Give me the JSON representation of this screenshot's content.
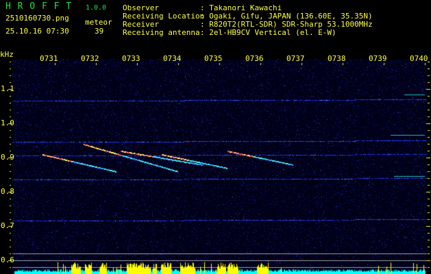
{
  "header": {
    "app_name": "H R O F F T",
    "version": "1.0.0",
    "filename": "2510160730.png",
    "datetime": "25.10.16 07:30",
    "meteor_label": "meteor",
    "meteor_count": "39",
    "info": [
      {
        "label": "Observer",
        "value": ": Takanori Kawachi"
      },
      {
        "label": "Receiving Location",
        "value": ": Ogaki, Gifu, JAPAN (136.60E, 35.35N)"
      },
      {
        "label": "Receiver",
        "value": ": R820T2(RTL-SDR) SDR-Sharp 53.1000MHz"
      },
      {
        "label": "Receiving antenna",
        "value": ": 2el-HB9CV Vertical (el. E-W)"
      }
    ]
  },
  "colors": {
    "text": "#ffff40",
    "title": "#20e040",
    "trace": "#3050ff",
    "histogram": "#00ffff",
    "burst": "#ffff00"
  },
  "chart_data": {
    "type": "heatmap",
    "title": "HROFFT spectrogram",
    "ylabel": "kHz",
    "xlabel": "",
    "x_ticks": [
      "0731",
      "0732",
      "0733",
      "0734",
      "0735",
      "0736",
      "0737",
      "0738",
      "0739",
      "0740"
    ],
    "y_ticks": [
      "1.1",
      "1.0",
      "0.9",
      "0.8",
      "0.7",
      "0.6"
    ],
    "ylim": [
      0.58,
      1.19
    ],
    "carrier_lines_khz": [
      1.065,
      0.945,
      0.905,
      0.835,
      0.715
    ],
    "meteor_echoes": [
      {
        "t_start": 730.7,
        "t_end": 732.5,
        "f_start": 0.91,
        "f_end": 0.86
      },
      {
        "t_start": 731.7,
        "t_end": 734.0,
        "f_start": 0.94,
        "f_end": 0.86
      },
      {
        "t_start": 732.6,
        "t_end": 734.6,
        "f_start": 0.92,
        "f_end": 0.88
      },
      {
        "t_start": 733.6,
        "t_end": 735.2,
        "f_start": 0.91,
        "f_end": 0.87
      },
      {
        "t_start": 735.2,
        "t_end": 736.8,
        "f_start": 0.92,
        "f_end": 0.88
      }
    ]
  }
}
